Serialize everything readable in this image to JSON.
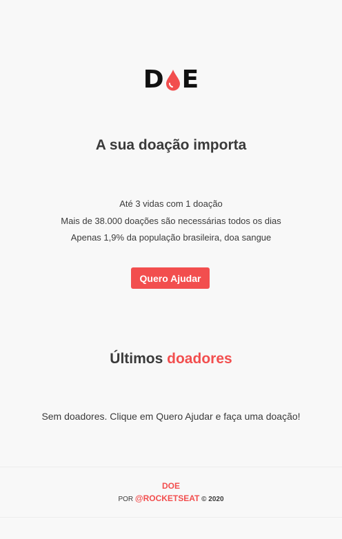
{
  "brand": {
    "logo_first": "D",
    "logo_last": "E",
    "accent_color": "#f24e4e",
    "drop_icon": "blood-drop-icon"
  },
  "hero": {
    "title": "A sua doação importa",
    "facts": [
      "Até 3 vidas com 1 doação",
      "Mais de 38.000 doações são necessárias todos os dias",
      "Apenas 1,9% da população brasileira, doa sangue"
    ],
    "button_label": "Quero Ajudar"
  },
  "donors": {
    "title_plain": "Últimos",
    "title_accent": "doadores",
    "empty_message": "Sem doadores. Clique em Quero Ajudar e faça uma doação!"
  },
  "footer": {
    "brand": "DOE",
    "by": "Por",
    "handle": "@rocketseat",
    "copyright": "© 2020"
  }
}
